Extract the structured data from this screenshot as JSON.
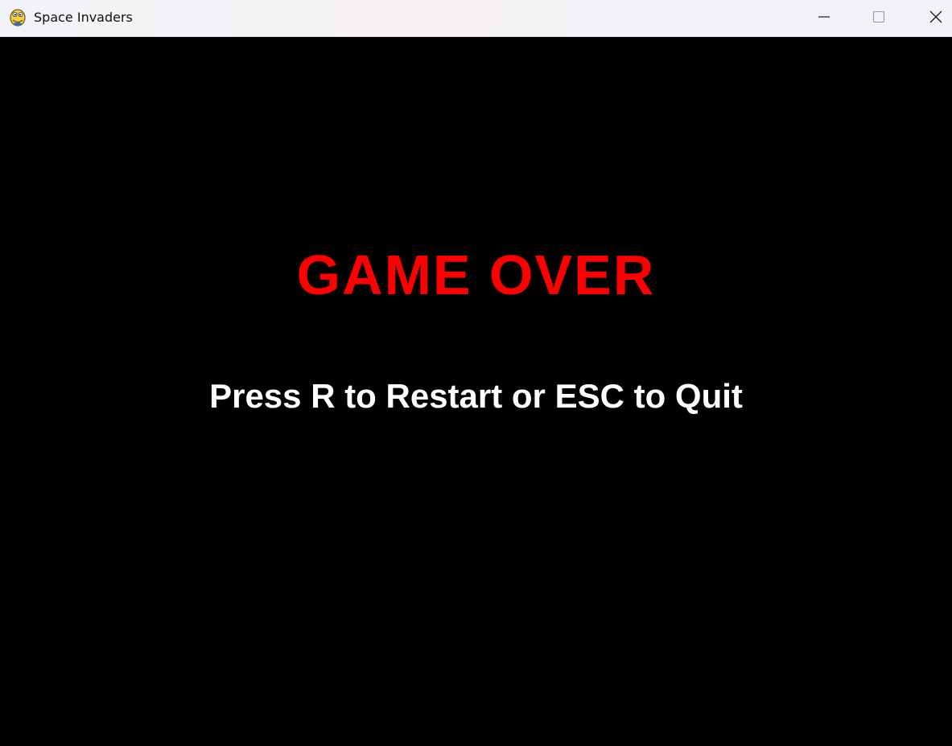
{
  "window": {
    "title": "Space Invaders",
    "app_icon": "python-snake-icon",
    "controls": {
      "minimize": "minimize-icon",
      "maximize": "maximize-icon",
      "close": "close-icon"
    }
  },
  "game": {
    "background_color": "#000000",
    "headline": "GAME OVER",
    "headline_color": "#ff0000",
    "instructions": "Press R to Restart or ESC to Quit",
    "instructions_color": "#ffffff"
  }
}
